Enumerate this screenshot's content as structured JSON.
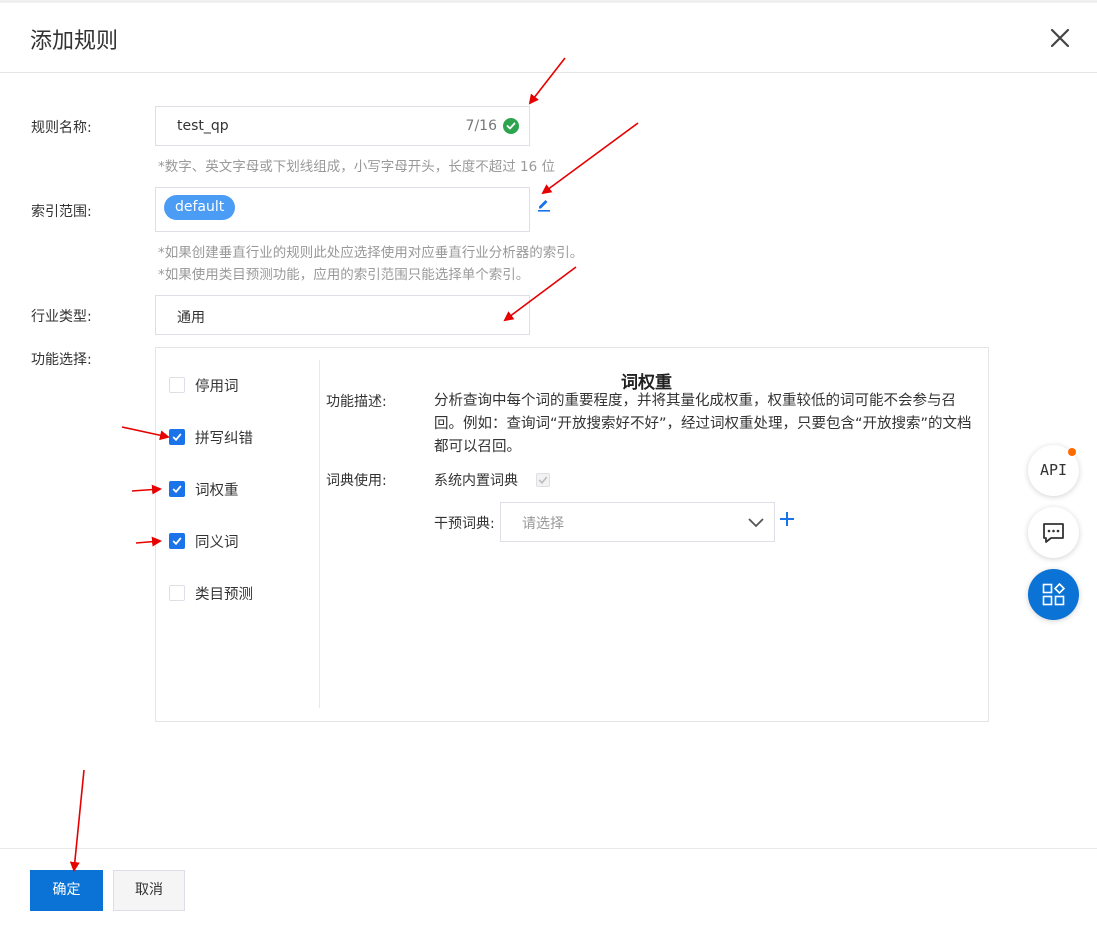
{
  "dialog": {
    "title": "添加规则"
  },
  "form": {
    "rule_name": {
      "label": "规则名称:",
      "value": "test_qp",
      "counter": "7/16",
      "hint": "*数字、英文字母或下划线组成，小写字母开头，长度不超过 16 位"
    },
    "index_scope": {
      "label": "索引范围:",
      "tag": "default",
      "hint1": "*如果创建垂直行业的规则此处应选择使用对应垂直行业分析器的索引。",
      "hint2": "*如果使用类目预测功能，应用的索引范围只能选择单个索引。"
    },
    "industry": {
      "label": "行业类型:",
      "value": "通用"
    },
    "features": {
      "label": "功能选择:",
      "items": [
        {
          "label": "停用词",
          "checked": false
        },
        {
          "label": "拼写纠错",
          "checked": true
        },
        {
          "label": "词权重",
          "checked": true
        },
        {
          "label": "同义词",
          "checked": true
        },
        {
          "label": "类目预测",
          "checked": false
        }
      ],
      "detail": {
        "title": "词权重",
        "desc_label": "功能描述:",
        "desc": "分析查询中每个词的重要程度，并将其量化成权重，权重较低的词可能不会参与召回。例如：查询词“开放搜索好不好”，经过词权重处理，只要包含“开放搜索”的文档都可以召回。",
        "dict_label": "词典使用:",
        "builtin_dict": "系统内置词典",
        "intervene_label": "干预词典:",
        "select_placeholder": "请选择"
      }
    }
  },
  "footer": {
    "confirm": "确定",
    "cancel": "取消"
  },
  "floating": {
    "api_label": "API"
  },
  "colors": {
    "primary": "#0a73d5",
    "tag": "#4b9cf5",
    "success": "#2ea44f",
    "annotation": "#e60000",
    "badge": "#ff6a00"
  }
}
